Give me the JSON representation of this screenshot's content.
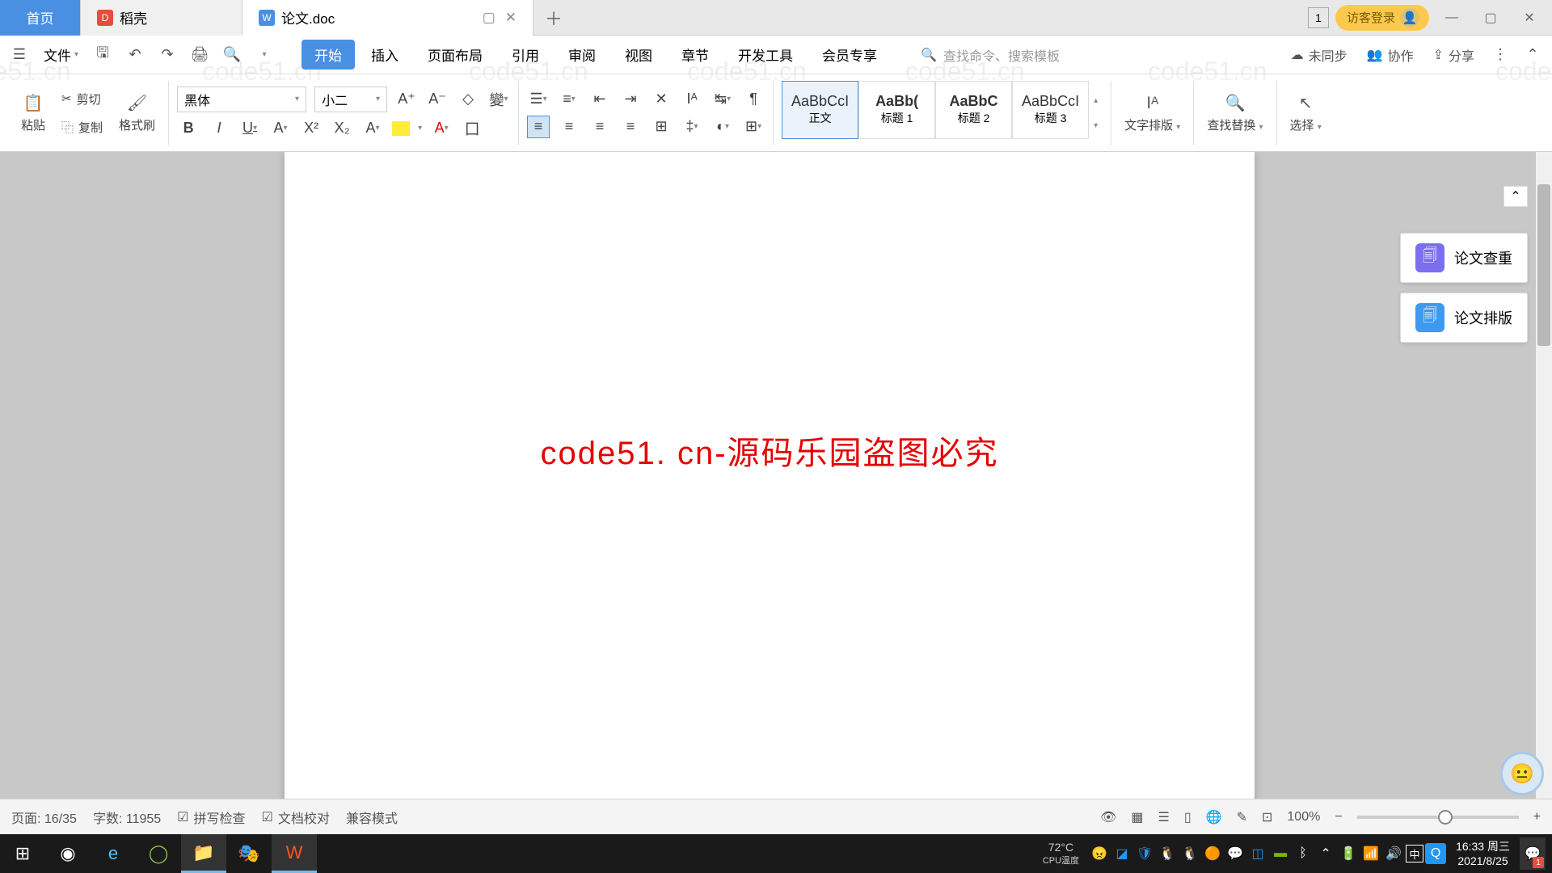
{
  "watermark_text": "code51.cn",
  "tabs": {
    "home": "首页",
    "daoke": "稻壳",
    "active": "论文.doc"
  },
  "titlebar": {
    "badge": "1",
    "login": "访客登录"
  },
  "menubar": {
    "file": "文件",
    "items": [
      "开始",
      "插入",
      "页面布局",
      "引用",
      "审阅",
      "视图",
      "章节",
      "开发工具",
      "会员专享"
    ],
    "search_placeholder": "查找命令、搜索模板",
    "unsync": "未同步",
    "collab": "协作",
    "share": "分享"
  },
  "ribbon": {
    "paste": "粘贴",
    "cut": "剪切",
    "copy": "复制",
    "format_painter": "格式刷",
    "font_name": "黑体",
    "font_size": "小二",
    "styles": [
      {
        "preview": "AaBbCcI",
        "name": "正文"
      },
      {
        "preview": "AaBb(",
        "name": "标题 1",
        "bold": true
      },
      {
        "preview": "AaBbC",
        "name": "标题 2",
        "bold": true
      },
      {
        "preview": "AaBbCcI",
        "name": "标题 3"
      }
    ],
    "text_layout": "文字排版",
    "find_replace": "查找替换",
    "select": "选择"
  },
  "side_panel": {
    "plagiarism": "论文查重",
    "formatting": "论文排版"
  },
  "document": {
    "red_text": "code51. cn-源码乐园盗图必究"
  },
  "statusbar": {
    "page": "页面: 16/35",
    "words": "字数: 11955",
    "spell": "拼写检查",
    "doc_check": "文档校对",
    "compat": "兼容模式",
    "zoom": "100%"
  },
  "taskbar": {
    "cpu_label": "CPU温度",
    "cpu_temp": "72°C",
    "ime": "中",
    "time": "16:33 周三",
    "date": "2021/8/25",
    "notif_count": "1"
  }
}
